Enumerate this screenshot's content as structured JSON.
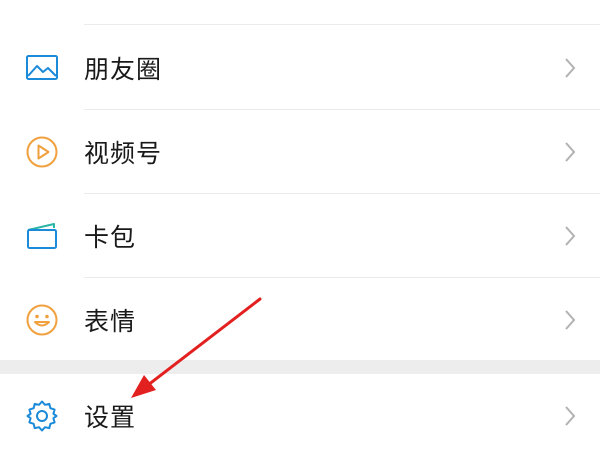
{
  "menu": {
    "items": [
      {
        "label": "朋友圈",
        "icon": "moments-picture-icon",
        "color": "#1a8ad9"
      },
      {
        "label": "视频号",
        "icon": "channels-play-icon",
        "color": "#f0a03c"
      },
      {
        "label": "卡包",
        "icon": "card-wallet-icon",
        "color": "#1a8ad9"
      },
      {
        "label": "表情",
        "icon": "sticker-smile-icon",
        "color": "#f0a03c"
      }
    ],
    "settings": {
      "label": "设置",
      "icon": "gear-icon",
      "color": "#1a8ad9"
    }
  },
  "annotation": {
    "arrow_color": "#e32020",
    "arrow_target": "settings"
  },
  "colors": {
    "background": "#ffffff",
    "section_gap": "#ededed",
    "divider": "#ececec",
    "text": "#191919",
    "chevron": "#b2b2b2"
  }
}
